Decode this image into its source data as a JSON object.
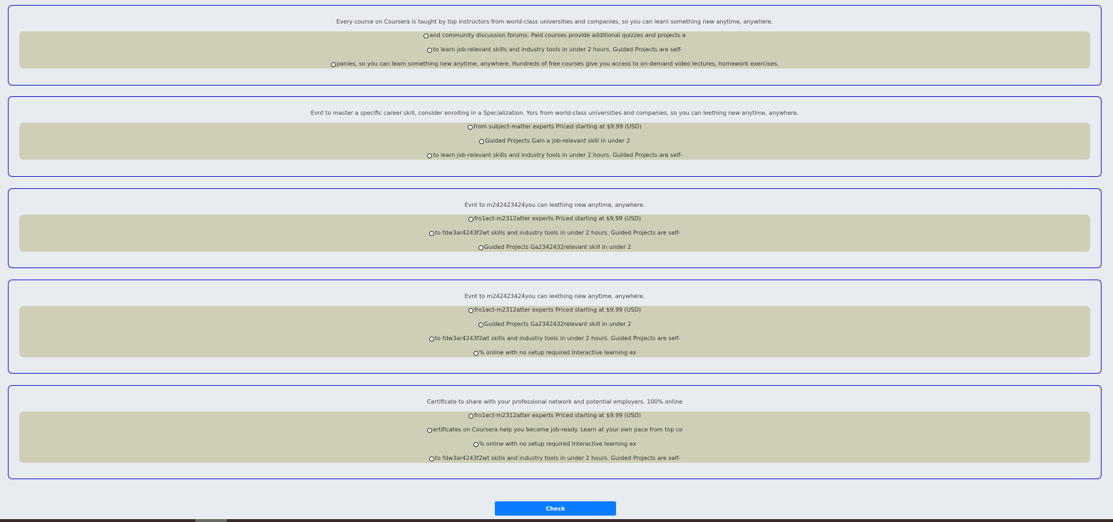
{
  "questions": [
    {
      "text": "Every course on Coursera is taught by top instructors from world-class universities and companies, so you can learn something new anytime, anywhere.",
      "options": [
        "and community discussion forums. Paid courses provide additional quizzes and projects a",
        " to learn job-relevant skills and industry tools in under 2 hours. Guided Projects are self-",
        "panies, so you can learn something new anytime, anywhere. Hundreds of free courses give you access to on-demand video lectures, homework exercises,"
      ]
    },
    {
      "text": "Evnt to master a specific career skill, consider enrolling in a Specialization. Yors from world-class universities and companies, so you can leething new anytime, anywhere.",
      "options": [
        "from subject-matter experts Priced starting at $9.99 (USD)",
        "Guided Projects Gain a job-relevant skill in under 2",
        " to learn job-relevant skills and industry tools in under 2 hours. Guided Projects are self-"
      ]
    },
    {
      "text": "Evnt to m242423424you can leething new anytime, anywhere.",
      "options": [
        "fro1ect-m2312atter experts Priced starting at $9.99 (USD)",
        " to fdw3ar4243f2wt skills and industry tools in under 2 hours. Guided Projects are self-",
        "Guided Projects Ga2342432relevant skill in under 2"
      ]
    },
    {
      "text": "Evnt to m242423424you can leething new anytime, anywhere.",
      "options": [
        "fro1ect-m2312atter experts Priced starting at $9.99 (USD)",
        "Guided Projects Ga2342432relevant skill in under 2",
        " to fdw3ar4243f2wt skills and industry tools in under 2 hours. Guided Projects are self-",
        "% online with no setup required Interactive learning ex"
      ]
    },
    {
      "text": "Certificate to share with your professional network and potential employers. 100% online",
      "options": [
        "fro1ect-m2312atter experts Priced starting at $9.99 (USD)",
        "ertificates on Coursera help you become job-ready. Learn at your own pace from top co",
        "% online with no setup required Interactive learning ex",
        " to fdw3ar4243f2wt skills and industry tools in under 2 hours. Guided Projects are self-"
      ]
    }
  ],
  "check_button_label": "Check",
  "colors": {
    "page_background": "#e8ebf0",
    "card_border": "#1f1fcf",
    "options_background": "#cfcfb8",
    "button_background": "#0a7cff",
    "button_text": "#ffffff"
  }
}
